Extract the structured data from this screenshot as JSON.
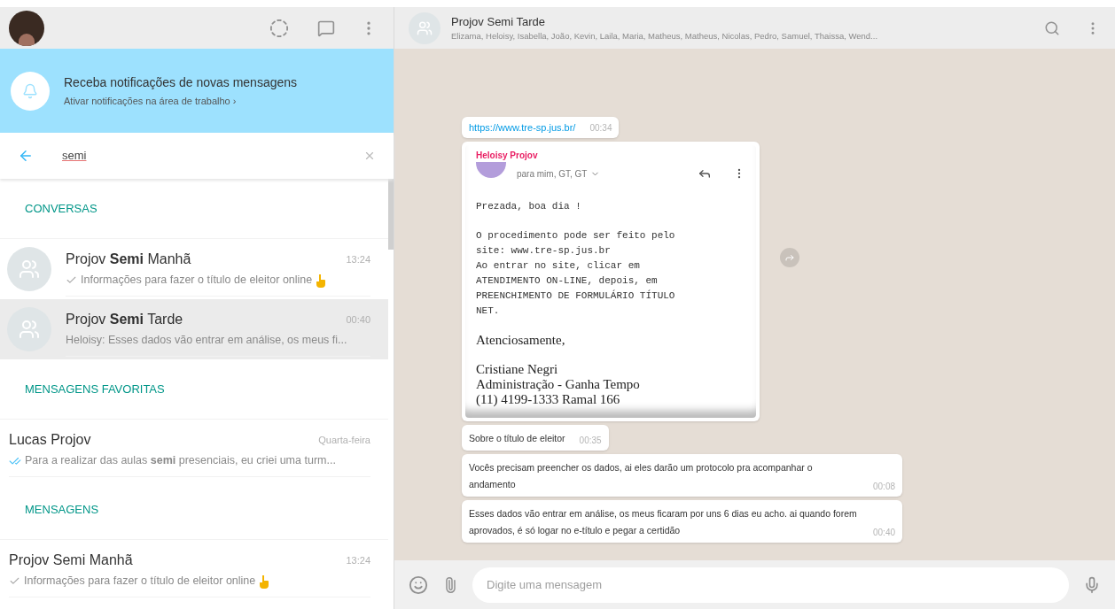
{
  "notification_banner": {
    "title": "Receba notificações de novas mensagens",
    "link": "Ativar notificações na área de trabalho ›"
  },
  "search": {
    "value": "semi"
  },
  "sections": [
    {
      "title": "CONVERSAS",
      "items": [
        {
          "kind": "chat",
          "name": "Projov **Semi** Manhã",
          "time": "13:24",
          "preview": "Informações para fazer o título de eleitor online",
          "ticked": true,
          "read": false,
          "hand": true,
          "selected": false
        },
        {
          "kind": "chat",
          "name": "Projov **Semi** Tarde",
          "time": "00:40",
          "preview": "Heloisy: Esses dados vão entrar em análise, os meus fi...",
          "ticked": false,
          "hand": false,
          "selected": true
        }
      ]
    },
    {
      "title": "MENSAGENS FAVORITAS",
      "items": [
        {
          "kind": "message",
          "name": "Lucas Projov",
          "time": "Quarta-feira",
          "preview": "Para a realizar das aulas **semi** presenciais, eu criei uma turm...",
          "ticked": true,
          "read": true,
          "hand": false,
          "selected": false
        }
      ]
    },
    {
      "title": "MENSAGENS",
      "items": [
        {
          "kind": "message",
          "name": "Projov Semi Manhã",
          "time": "13:24",
          "preview": "Informações para fazer o título de eleitor online",
          "ticked": true,
          "read": false,
          "hand": true,
          "selected": false
        }
      ]
    }
  ],
  "chat": {
    "title": "Projov Semi Tarde",
    "members": "Elizama, Heloisy, Isabella, João, Kevin, Laila, Maria, Matheus, Matheus, Nicolas, Pedro, Samuel, Thaissa, Wend..."
  },
  "messages": [
    {
      "kind": "link",
      "text": "https://www.tre-sp.jus.br/",
      "time": "00:34"
    },
    {
      "kind": "email",
      "sender": "Heloisy Projov",
      "recipients": "para mim, GT, GT",
      "greeting": "Prezada, boa dia !",
      "body": "O procedimento pode ser feito pelo site: www.tre-sp.jus.br\nAo entrar no site, clicar em ATENDIMENTO ON-LINE, depois, em PREENCHIMENTO DE FORMULÁRIO TÍTULO NET.",
      "closing": "Atenciosamente,",
      "signature": "Cristiane Negri\nAdministração - Ganha Tempo\n(11) 4199-1333 Ramal 166"
    },
    {
      "kind": "text",
      "text": "Sobre o título de eleitor",
      "time": "00:35"
    },
    {
      "kind": "text",
      "text": "Vocês precisam preencher os dados, ai eles darão um protocolo pra acompanhar o andamento",
      "time": "00:08"
    },
    {
      "kind": "text",
      "text": "Esses dados vão entrar em análise, os meus ficaram por uns 6 dias eu acho. ai quando forem aprovados, é só logar no e-título e pegar a certidão",
      "time": "00:40"
    }
  ],
  "composer": {
    "placeholder": "Digite uma mensagem"
  }
}
